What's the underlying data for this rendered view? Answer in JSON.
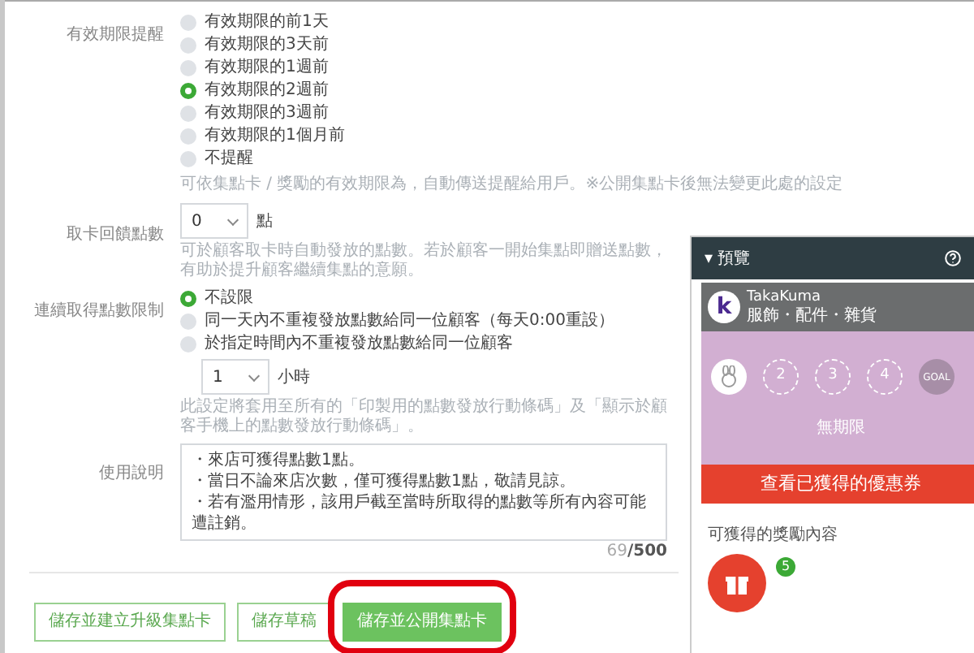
{
  "expiry_reminder": {
    "label": "有效期限提醒",
    "options": [
      {
        "label": "有效期限的前1天",
        "selected": false
      },
      {
        "label": "有效期限的3天前",
        "selected": false
      },
      {
        "label": "有效期限的1週前",
        "selected": false
      },
      {
        "label": "有效期限的2週前",
        "selected": true
      },
      {
        "label": "有效期限的3週前",
        "selected": false
      },
      {
        "label": "有效期限的1個月前",
        "selected": false
      },
      {
        "label": "不提醒",
        "selected": false
      }
    ],
    "help": "可依集點卡 / 獎勵的有效期限為，自動傳送提醒給用戶。※公開集點卡後無法變更此處的設定"
  },
  "bonus_points": {
    "label": "取卡回饋點數",
    "value": "0",
    "unit": "點",
    "help": "可於顧客取卡時自動發放的點數。若於顧客一開始集點即贈送點數，有助於提升顧客繼續集點的意願。"
  },
  "limit": {
    "label": "連續取得點數限制",
    "options": [
      {
        "label": "不設限",
        "selected": true
      },
      {
        "label": "同一天內不重複發放點數給同一位顧客（每天0:00重設）",
        "selected": false
      },
      {
        "label": "於指定時間內不重複發放點數給同一位顧客",
        "selected": false
      }
    ],
    "hours": {
      "value": "1",
      "unit": "小時"
    },
    "help": "此設定將套用至所有的「印製用的點數發放行動條碼」及「顯示於顧客手機上的點數發放行動條碼」。"
  },
  "usage": {
    "label": "使用說明",
    "lines": [
      "・來店可獲得點數1點。",
      "・當日不論來店次數，僅可獲得點數1點，敬請見諒。",
      "・若有濫用情形，該用戶截至當時所取得的點數等所有內容可能遭註銷。"
    ],
    "count": "69",
    "max": "/500"
  },
  "buttons": [
    {
      "label": "儲存並建立升級集點卡",
      "kind": "outline"
    },
    {
      "label": "儲存草稿",
      "kind": "outline"
    },
    {
      "label": "儲存並公開集點卡",
      "kind": "primary",
      "highlighted": true
    }
  ],
  "preview": {
    "title": "▾ 預覽",
    "shop": {
      "initial": "k",
      "name": "TakaKuma",
      "category": "服飾・配件・雜貨"
    },
    "stamps": [
      {
        "kind": "stamped"
      },
      {
        "kind": "empty",
        "label": "2"
      },
      {
        "kind": "empty",
        "label": "3"
      },
      {
        "kind": "empty",
        "label": "4"
      },
      {
        "kind": "goal",
        "label": "GOAL"
      }
    ],
    "validity": "無期限",
    "coupon_button": "查看已獲得的優惠券",
    "rewards_title": "可獲得的獎勵內容",
    "reward_badge": "5"
  }
}
